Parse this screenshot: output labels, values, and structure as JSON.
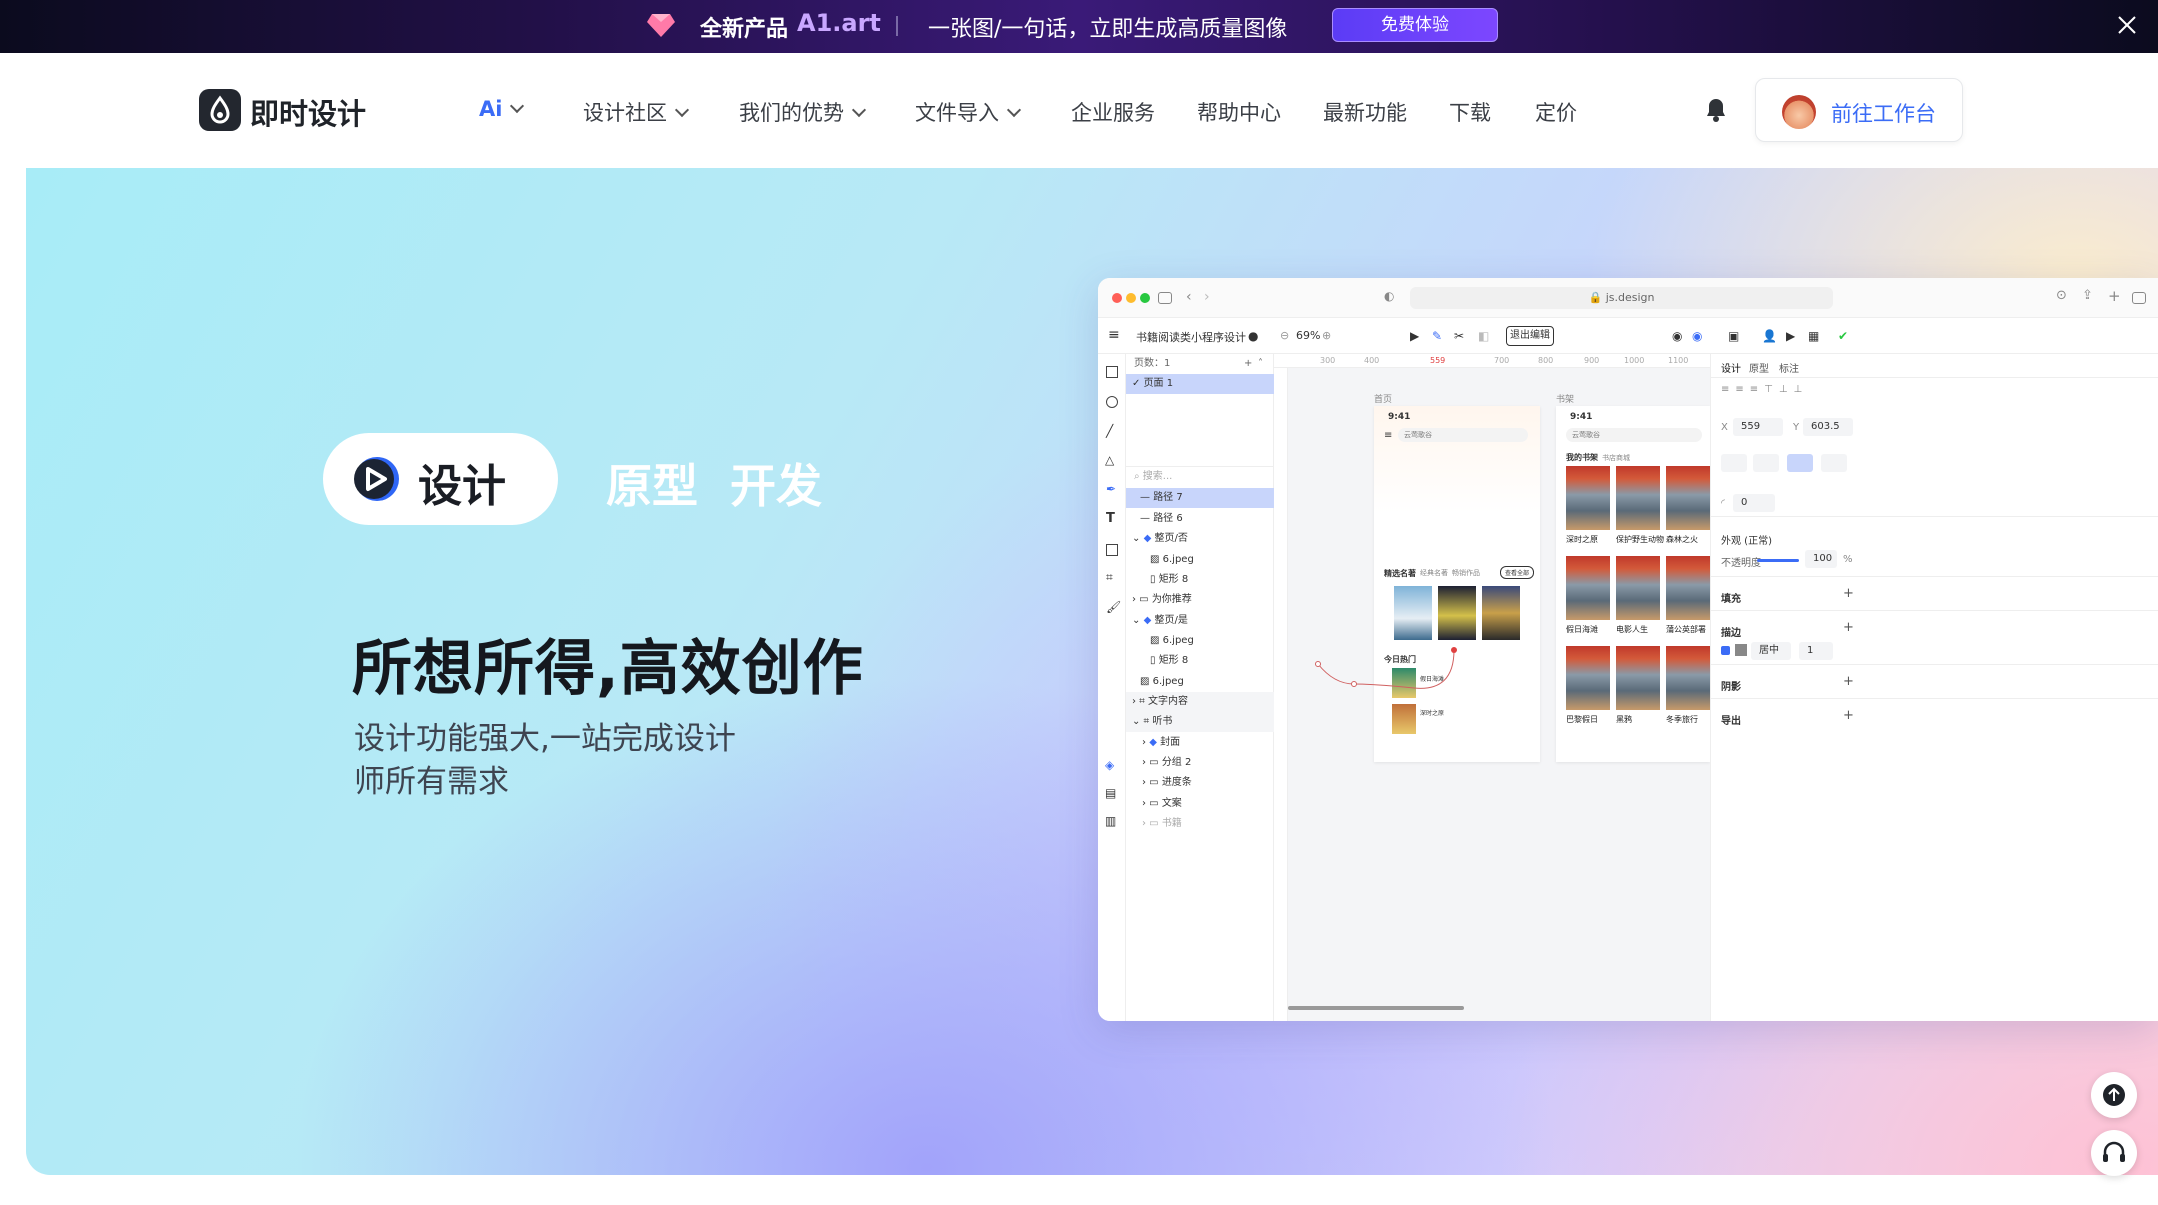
{
  "promo": {
    "title": "全新产品",
    "brand": "A1.art",
    "tagline": "一张图/一句话，立即生成高质量图像",
    "cta": "免费体验"
  },
  "nav": {
    "logo_text": "即时设计",
    "items": [
      {
        "label": "Ai",
        "has_menu": true
      },
      {
        "label": "设计社区",
        "has_menu": true
      },
      {
        "label": "我们的优势",
        "has_menu": true
      },
      {
        "label": "文件导入",
        "has_menu": true
      },
      {
        "label": "企业服务",
        "has_menu": false
      },
      {
        "label": "帮助中心",
        "has_menu": false
      },
      {
        "label": "最新功能",
        "has_menu": false
      },
      {
        "label": "下载",
        "has_menu": false
      },
      {
        "label": "定价",
        "has_menu": false
      }
    ],
    "workspace_button": "前往工作台"
  },
  "hero": {
    "tabs": [
      "设计",
      "原型",
      "开发"
    ],
    "headline": "所想所得,高效创作",
    "subtitle": "设计功能强大,一站完成设计师所有需求"
  },
  "app": {
    "url": "js.design",
    "file_name": "书籍阅读类小程序设计",
    "zoom": "69%",
    "exit_button": "退出编辑",
    "pages_label": "页数：1",
    "page_name": "页面 1",
    "search_placeholder": "搜索...",
    "layers": [
      "路径 7",
      "路径 6",
      "整页/否",
      "6.jpeg",
      "矩形 8",
      "为你推荐",
      "整页/是",
      "6.jpeg",
      "矩形 8",
      "6.jpeg",
      "文字内容",
      "听书",
      "封面",
      "分组 2",
      "进度条",
      "文案",
      "书籍"
    ],
    "ruler_ticks": [
      "300",
      "400",
      "559",
      "700",
      "800",
      "900",
      "1000",
      "1100"
    ],
    "frames": {
      "home": {
        "label": "首页",
        "time": "9:41",
        "search": "云莺歌谷",
        "section_tabs": [
          "精选名著",
          "经典名著",
          "畅销作品"
        ],
        "all_btn": "查看全部",
        "today_hot": "今日热门",
        "hot_items": [
          "假日海滩",
          "深时之原"
        ]
      },
      "shelf": {
        "label": "书架",
        "time": "9:41",
        "search": "云莺歌谷",
        "tabs": [
          "我的书架",
          "书店商城"
        ],
        "books": [
          "深时之原",
          "保护野生动物",
          "森林之火",
          "假日海滩",
          "电影人生",
          "蒲公英部署",
          "巴黎假日",
          "黑鸦",
          "冬季旅行"
        ]
      }
    },
    "props": {
      "tabs": [
        "设计",
        "原型",
        "标注"
      ],
      "x_label": "X",
      "x_value": "559",
      "y_label": "Y",
      "y_value": "603.5",
      "radius": "0",
      "appearance": "外观 (正常)",
      "opacity_label": "不透明度",
      "opacity_value": "100",
      "opacity_unit": "%",
      "fill": "填充",
      "stroke": "描边",
      "stroke_align": "居中",
      "stroke_width": "1",
      "shadow": "阴影",
      "export": "导出"
    }
  },
  "colors": {
    "brand_blue": "#3b6cf6",
    "promo_accent": "#7d47ff",
    "selection": "#c8d5fb"
  }
}
